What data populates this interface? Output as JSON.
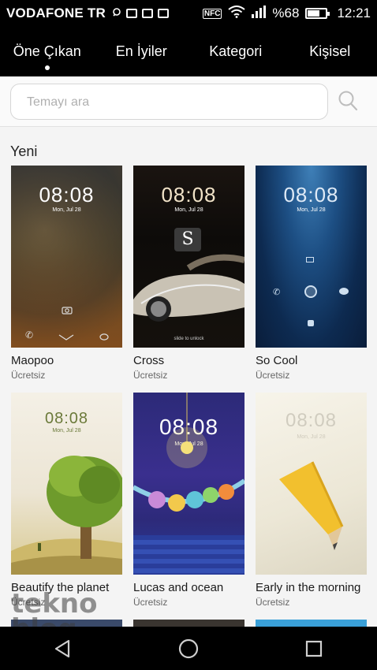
{
  "status_bar": {
    "carrier": "VODAFONE TR",
    "nfc": "NFC",
    "battery_text": "%68",
    "battery_level": 0.68,
    "time": "12:21"
  },
  "tabs": [
    {
      "label": "Öne Çıkan",
      "active": true
    },
    {
      "label": "En İyiler",
      "active": false
    },
    {
      "label": "Kategori",
      "active": false
    },
    {
      "label": "Kişisel",
      "active": false
    }
  ],
  "search": {
    "placeholder": "Temayı ara"
  },
  "section": {
    "title": "Yeni"
  },
  "themes": [
    {
      "title": "Maopoo",
      "price": "Ücretsiz",
      "clock": "08:08",
      "date": "Mon, Jul 28"
    },
    {
      "title": "Cross",
      "price": "Ücretsiz",
      "clock": "08:08",
      "date": "Mon, Jul 28",
      "caption": "slide to unlock"
    },
    {
      "title": "So Cool",
      "price": "Ücretsiz",
      "clock": "08:08",
      "date": "Mon, Jul 28"
    },
    {
      "title": "Beautify the planet",
      "price": "Ücretsiz",
      "clock": "08:08",
      "date": "Mon, Jul 28"
    },
    {
      "title": "Lucas and ocean",
      "price": "Ücretsiz",
      "clock": "08:08",
      "date": "Mon, Jul 28"
    },
    {
      "title": "Early in the morning",
      "price": "Ücretsiz",
      "clock": "08:08",
      "date": "Mon, Jul 28"
    }
  ],
  "watermark": {
    "line1": "tekno",
    "line2": "blog"
  },
  "icons": {
    "search": "search-icon",
    "back": "back-triangle-icon",
    "home": "home-circle-icon",
    "recents": "recents-square-icon"
  }
}
